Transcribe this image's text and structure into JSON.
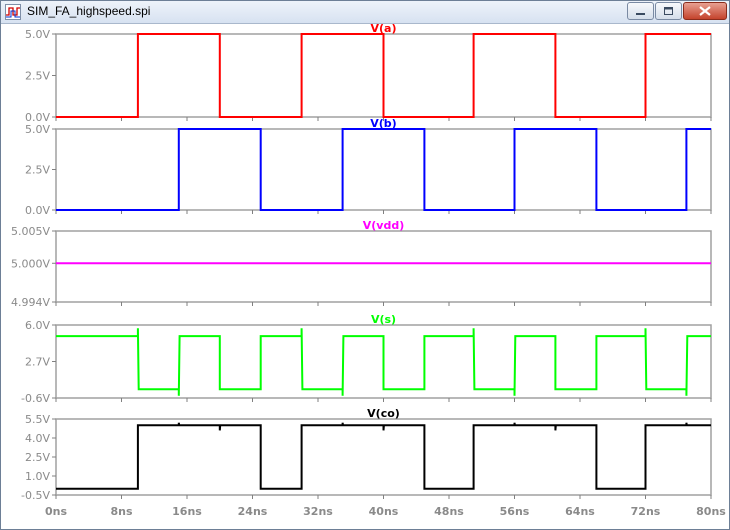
{
  "window": {
    "title": "SIM_FA_highspeed.spi"
  },
  "icons": {
    "app": "waveform-icon",
    "minimize": "minimize-icon",
    "maximize": "maximize-icon",
    "close": "close-icon"
  },
  "chart_data": {
    "type": "line",
    "xlabel": "",
    "xlim": [
      0,
      80
    ],
    "xticks": [
      "0ns",
      "8ns",
      "16ns",
      "24ns",
      "32ns",
      "40ns",
      "48ns",
      "56ns",
      "64ns",
      "72ns",
      "80ns"
    ],
    "grid": false,
    "panes": [
      {
        "name": "V(a)",
        "color": "#ff0000",
        "ylim": [
          0,
          5
        ],
        "yticks": [
          {
            "v": 0,
            "label": "0.0V"
          },
          {
            "v": 2.5,
            "label": "2.5V"
          },
          {
            "v": 5,
            "label": "5.0V"
          }
        ],
        "points": [
          [
            0,
            0
          ],
          [
            10,
            0
          ],
          [
            10,
            5
          ],
          [
            20,
            5
          ],
          [
            20,
            0
          ],
          [
            30,
            0
          ],
          [
            30,
            5
          ],
          [
            40,
            5
          ],
          [
            40,
            0
          ],
          [
            51,
            0
          ],
          [
            51,
            5
          ],
          [
            61,
            5
          ],
          [
            61,
            0
          ],
          [
            72,
            0
          ],
          [
            72,
            5
          ],
          [
            80,
            5
          ]
        ]
      },
      {
        "name": "V(b)",
        "color": "#0000ff",
        "ylim": [
          0,
          5
        ],
        "yticks": [
          {
            "v": 0,
            "label": "0.0V"
          },
          {
            "v": 2.5,
            "label": "2.5V"
          },
          {
            "v": 5,
            "label": "5.0V"
          }
        ],
        "points": [
          [
            0,
            0
          ],
          [
            15,
            0
          ],
          [
            15,
            5
          ],
          [
            25,
            5
          ],
          [
            25,
            0
          ],
          [
            35,
            0
          ],
          [
            35,
            5
          ],
          [
            45,
            5
          ],
          [
            45,
            0
          ],
          [
            56,
            0
          ],
          [
            56,
            5
          ],
          [
            66,
            5
          ],
          [
            66,
            0
          ],
          [
            77,
            0
          ],
          [
            77,
            5
          ],
          [
            80,
            5
          ]
        ]
      },
      {
        "name": "V(vdd)",
        "color": "#ff00ff",
        "ylim": [
          4.994,
          5.005
        ],
        "yticks": [
          {
            "v": 4.994,
            "label": "4.994V"
          },
          {
            "v": 5.0,
            "label": "5.000V"
          },
          {
            "v": 5.005,
            "label": "5.005V"
          }
        ],
        "points": [
          [
            0,
            5.0
          ],
          [
            80,
            5.0
          ]
        ]
      },
      {
        "name": "V(s)",
        "color": "#00ff00",
        "ylim": [
          -0.6,
          6.0
        ],
        "yticks": [
          {
            "v": -0.6,
            "label": "-0.6V"
          },
          {
            "v": 2.7,
            "label": "2.7V"
          },
          {
            "v": 6.0,
            "label": "6.0V"
          }
        ],
        "points": [
          [
            0,
            5.0
          ],
          [
            10,
            5.0
          ],
          [
            10,
            5.7
          ],
          [
            10.1,
            0.2
          ],
          [
            15,
            0.2
          ],
          [
            15,
            -0.4
          ],
          [
            15.1,
            5.0
          ],
          [
            20,
            5.0
          ],
          [
            20,
            0.2
          ],
          [
            25,
            0.2
          ],
          [
            25,
            5.0
          ],
          [
            30,
            5.0
          ],
          [
            30,
            5.7
          ],
          [
            30.1,
            0.2
          ],
          [
            35,
            0.2
          ],
          [
            35,
            -0.4
          ],
          [
            35.1,
            5.0
          ],
          [
            40,
            5.0
          ],
          [
            40,
            0.2
          ],
          [
            45,
            0.2
          ],
          [
            45,
            5.0
          ],
          [
            51,
            5.0
          ],
          [
            51,
            5.7
          ],
          [
            51.1,
            0.2
          ],
          [
            56,
            0.2
          ],
          [
            56,
            -0.4
          ],
          [
            56.1,
            5.0
          ],
          [
            61,
            5.0
          ],
          [
            61,
            0.2
          ],
          [
            66,
            0.2
          ],
          [
            66,
            5.0
          ],
          [
            72,
            5.0
          ],
          [
            72,
            5.7
          ],
          [
            72.1,
            0.2
          ],
          [
            77,
            0.2
          ],
          [
            77,
            -0.4
          ],
          [
            77.1,
            5.0
          ],
          [
            80,
            5.0
          ]
        ]
      },
      {
        "name": "V(co)",
        "color": "#000000",
        "ylim": [
          -0.5,
          5.5
        ],
        "yticks": [
          {
            "v": -0.5,
            "label": "-0.5V"
          },
          {
            "v": 1.0,
            "label": "1.0V"
          },
          {
            "v": 2.5,
            "label": "2.5V"
          },
          {
            "v": 4.0,
            "label": "4.0V"
          },
          {
            "v": 5.5,
            "label": "5.5V"
          }
        ],
        "points": [
          [
            0,
            0
          ],
          [
            10,
            0
          ],
          [
            10,
            5.0
          ],
          [
            15,
            5.0
          ],
          [
            15,
            5.2
          ],
          [
            15.05,
            5.0
          ],
          [
            20,
            5.0
          ],
          [
            20,
            4.6
          ],
          [
            20.05,
            5.0
          ],
          [
            25,
            5.0
          ],
          [
            25,
            0
          ],
          [
            30,
            0
          ],
          [
            30,
            5.0
          ],
          [
            35,
            5.0
          ],
          [
            35,
            5.2
          ],
          [
            35.05,
            5.0
          ],
          [
            40,
            5.0
          ],
          [
            40,
            4.6
          ],
          [
            40.05,
            5.0
          ],
          [
            45,
            5.0
          ],
          [
            45,
            0
          ],
          [
            51,
            0
          ],
          [
            51,
            5.0
          ],
          [
            56,
            5.0
          ],
          [
            56,
            5.2
          ],
          [
            56.05,
            5.0
          ],
          [
            61,
            5.0
          ],
          [
            61,
            4.6
          ],
          [
            61.05,
            5.0
          ],
          [
            66,
            5.0
          ],
          [
            66,
            0
          ],
          [
            72,
            0
          ],
          [
            72,
            5.0
          ],
          [
            77,
            5.0
          ],
          [
            77,
            5.2
          ],
          [
            77.05,
            5.0
          ],
          [
            80,
            5.0
          ]
        ]
      }
    ]
  }
}
